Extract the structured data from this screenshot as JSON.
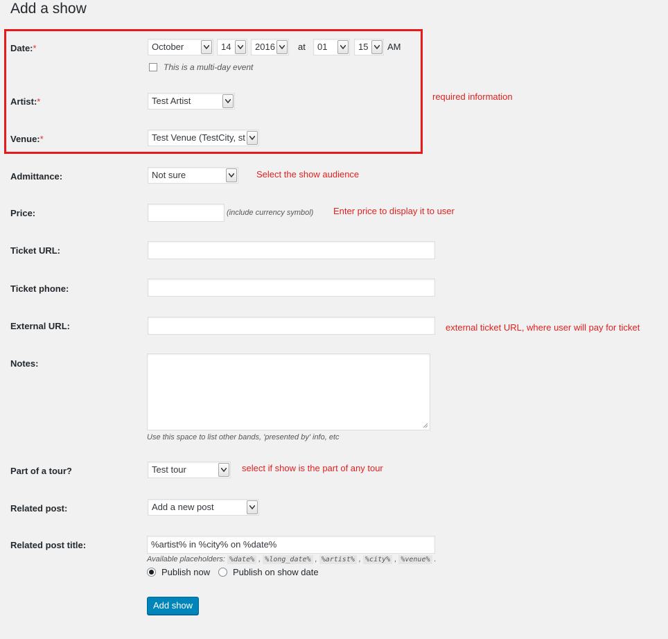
{
  "page": {
    "title": "Add a show"
  },
  "form": {
    "date": {
      "label": "Date:",
      "required": "*",
      "month": "October",
      "day": "14",
      "year": "2016",
      "at": "at",
      "hour": "01",
      "minute": "15",
      "ampm": "AM",
      "multi_day_label": "This is a multi-day event"
    },
    "artist": {
      "label": "Artist:",
      "required": "*",
      "value": "Test Artist"
    },
    "venue": {
      "label": "Venue:",
      "required": "*",
      "value": "Test Venue (TestCity, st"
    },
    "admittance": {
      "label": "Admittance:",
      "value": "Not sure"
    },
    "price": {
      "label": "Price:",
      "value": "",
      "hint": "(include currency symbol)"
    },
    "ticket_url": {
      "label": "Ticket URL:",
      "value": ""
    },
    "ticket_phone": {
      "label": "Ticket phone:",
      "value": ""
    },
    "external_url": {
      "label": "External URL:",
      "value": ""
    },
    "notes": {
      "label": "Notes:",
      "value": "",
      "hint": "Use this space to list other bands, 'presented by' info, etc"
    },
    "tour": {
      "label": "Part of a tour?",
      "value": "Test tour"
    },
    "related_post": {
      "label": "Related post:",
      "value": "Add a new post"
    },
    "related_post_title": {
      "label": "Related post title:",
      "value": "%artist% in %city% on %date%",
      "placeholders_label": "Available placeholders:",
      "placeholders": [
        "%date%",
        "%long_date%",
        "%artist%",
        "%city%",
        "%venue%"
      ]
    },
    "publish": {
      "now": "Publish now",
      "show_date": "Publish on show date"
    },
    "submit": "Add show"
  },
  "annotations": {
    "required": "required information",
    "admittance": "Select the show audience",
    "price": "Enter price to display it to user",
    "external_url": "external ticket URL, where user will pay for ticket",
    "tour": "select if show is the part of any tour"
  },
  "colors": {
    "annotation": "#e0201f",
    "button": "#0085ba",
    "required": "#dc3232"
  }
}
